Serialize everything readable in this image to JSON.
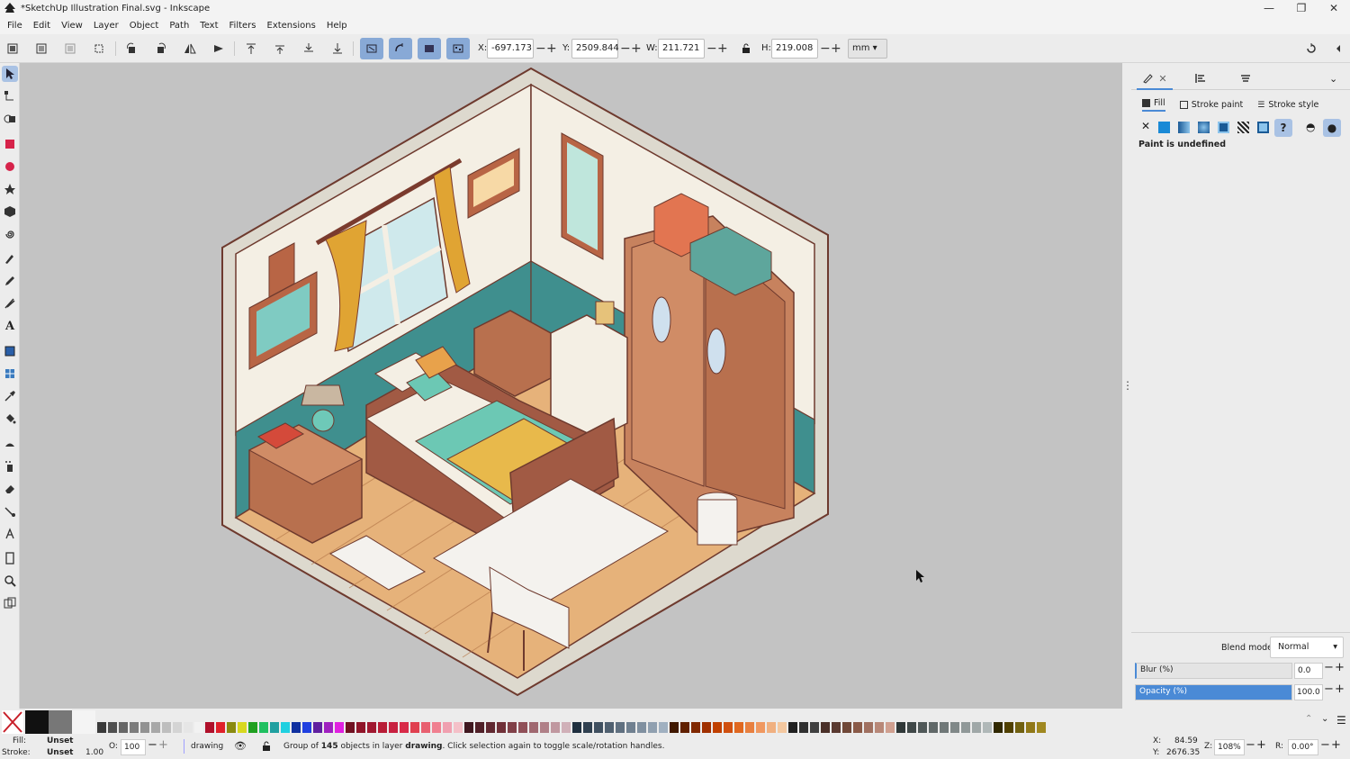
{
  "window": {
    "title": "*SketchUp Illustration Final.svg - Inkscape",
    "controls": [
      "—",
      "❐",
      "✕"
    ]
  },
  "menu": [
    "File",
    "Edit",
    "View",
    "Layer",
    "Object",
    "Path",
    "Text",
    "Filters",
    "Extensions",
    "Help"
  ],
  "toolbar": {
    "x_label": "X:",
    "x_value": "-697.173",
    "y_label": "Y:",
    "y_value": "2509.844",
    "w_label": "W:",
    "w_value": "211.721",
    "h_label": "H:",
    "h_value": "219.008",
    "unit": "mm"
  },
  "dock": {
    "tabs": [
      "Fill",
      "Stroke paint",
      "Stroke style"
    ],
    "message": "Paint is undefined",
    "blend_label": "Blend mode:",
    "blend_value": "Normal",
    "blur_label": "Blur (%)",
    "blur_value": "0.0",
    "opacity_label": "Opacity (%)",
    "opacity_value": "100.0",
    "opacity_fraction": 1.0
  },
  "status": {
    "fill_label": "Fill:",
    "fill_value": "Unset",
    "stroke_label": "Stroke:",
    "stroke_value": "Unset",
    "stroke_width": "1.00",
    "opacity_label": "O:",
    "opacity_value": "100",
    "layer": "drawing",
    "message_prefix": "Group of ",
    "count": "145",
    "message_mid": " objects in layer ",
    "layer_bold": "drawing",
    "message_suffix": ". Click selection again to toggle scale/rotation handles.",
    "cursor_x_label": "X:",
    "cursor_x": "84.59",
    "cursor_y_label": "Y:",
    "cursor_y": "2676.35",
    "zoom_label": "Z:",
    "zoom": "108%",
    "rotation_label": "R:",
    "rotation": "0.00°"
  },
  "colors": {
    "accent": "#4a8ad6",
    "selected_tool": "#a9c2e4",
    "canvas": "#c3c3c3"
  }
}
